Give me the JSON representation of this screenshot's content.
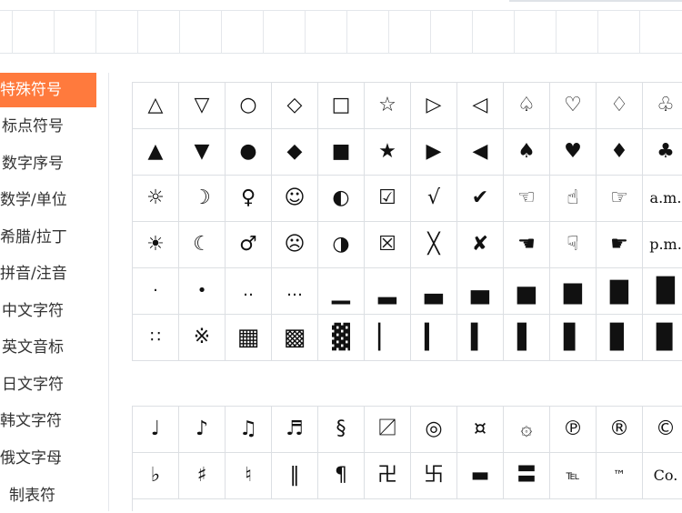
{
  "sidebar": {
    "items": [
      {
        "label": "特殊符号",
        "active": true
      },
      {
        "label": "标点符号",
        "active": false
      },
      {
        "label": "数字序号",
        "active": false
      },
      {
        "label": "数学/单位",
        "active": false
      },
      {
        "label": "希腊/拉丁",
        "active": false
      },
      {
        "label": "拼音/注音",
        "active": false
      },
      {
        "label": "中文字符",
        "active": false
      },
      {
        "label": "英文音标",
        "active": false
      },
      {
        "label": "日文字符",
        "active": false
      },
      {
        "label": "韩文字符",
        "active": false
      },
      {
        "label": "俄文字母",
        "active": false
      },
      {
        "label": "制表符",
        "active": false
      }
    ]
  },
  "colors": {
    "accent": "#ff7a3d",
    "grid_line": "#dcdfe3",
    "text": "#333333"
  },
  "symbols_panel_1": [
    [
      "△",
      "▽",
      "○",
      "◇",
      "□",
      "☆",
      "▷",
      "◁",
      "♤",
      "♡",
      "♢",
      "♧"
    ],
    [
      "▲",
      "▼",
      "●",
      "◆",
      "■",
      "★",
      "▶",
      "◀",
      "♠",
      "♥",
      "♦",
      "♣"
    ],
    [
      "☼",
      "☽",
      "♀",
      "☺",
      "◐",
      "☑",
      "√",
      "✔",
      "☜",
      "☝",
      "☞",
      "a.m."
    ],
    [
      "☀",
      "☾",
      "♂",
      "☹",
      "◑",
      "☒",
      "╳",
      "✘",
      "☚",
      "☟",
      "☛",
      "p.m."
    ],
    [
      "·",
      "•",
      "‥",
      "…",
      "▁",
      "▂",
      "▃",
      "▄",
      "▅",
      "▆",
      "▇",
      "█"
    ],
    [
      "∷",
      "※",
      "▦",
      "▩",
      "▓",
      "▏",
      "▎",
      "▍",
      "▌",
      "▋",
      "▊",
      "▉"
    ]
  ],
  "symbols_panel_2": [
    [
      "♩",
      "♪",
      "♫",
      "♬",
      "§",
      "〼",
      "◎",
      "¤",
      "۞",
      "℗",
      "®",
      "©"
    ],
    [
      "♭",
      "♯",
      "♮",
      "‖",
      "¶",
      "卍",
      "卐",
      "▬",
      "〓",
      "℡",
      "™",
      "Co."
    ]
  ]
}
